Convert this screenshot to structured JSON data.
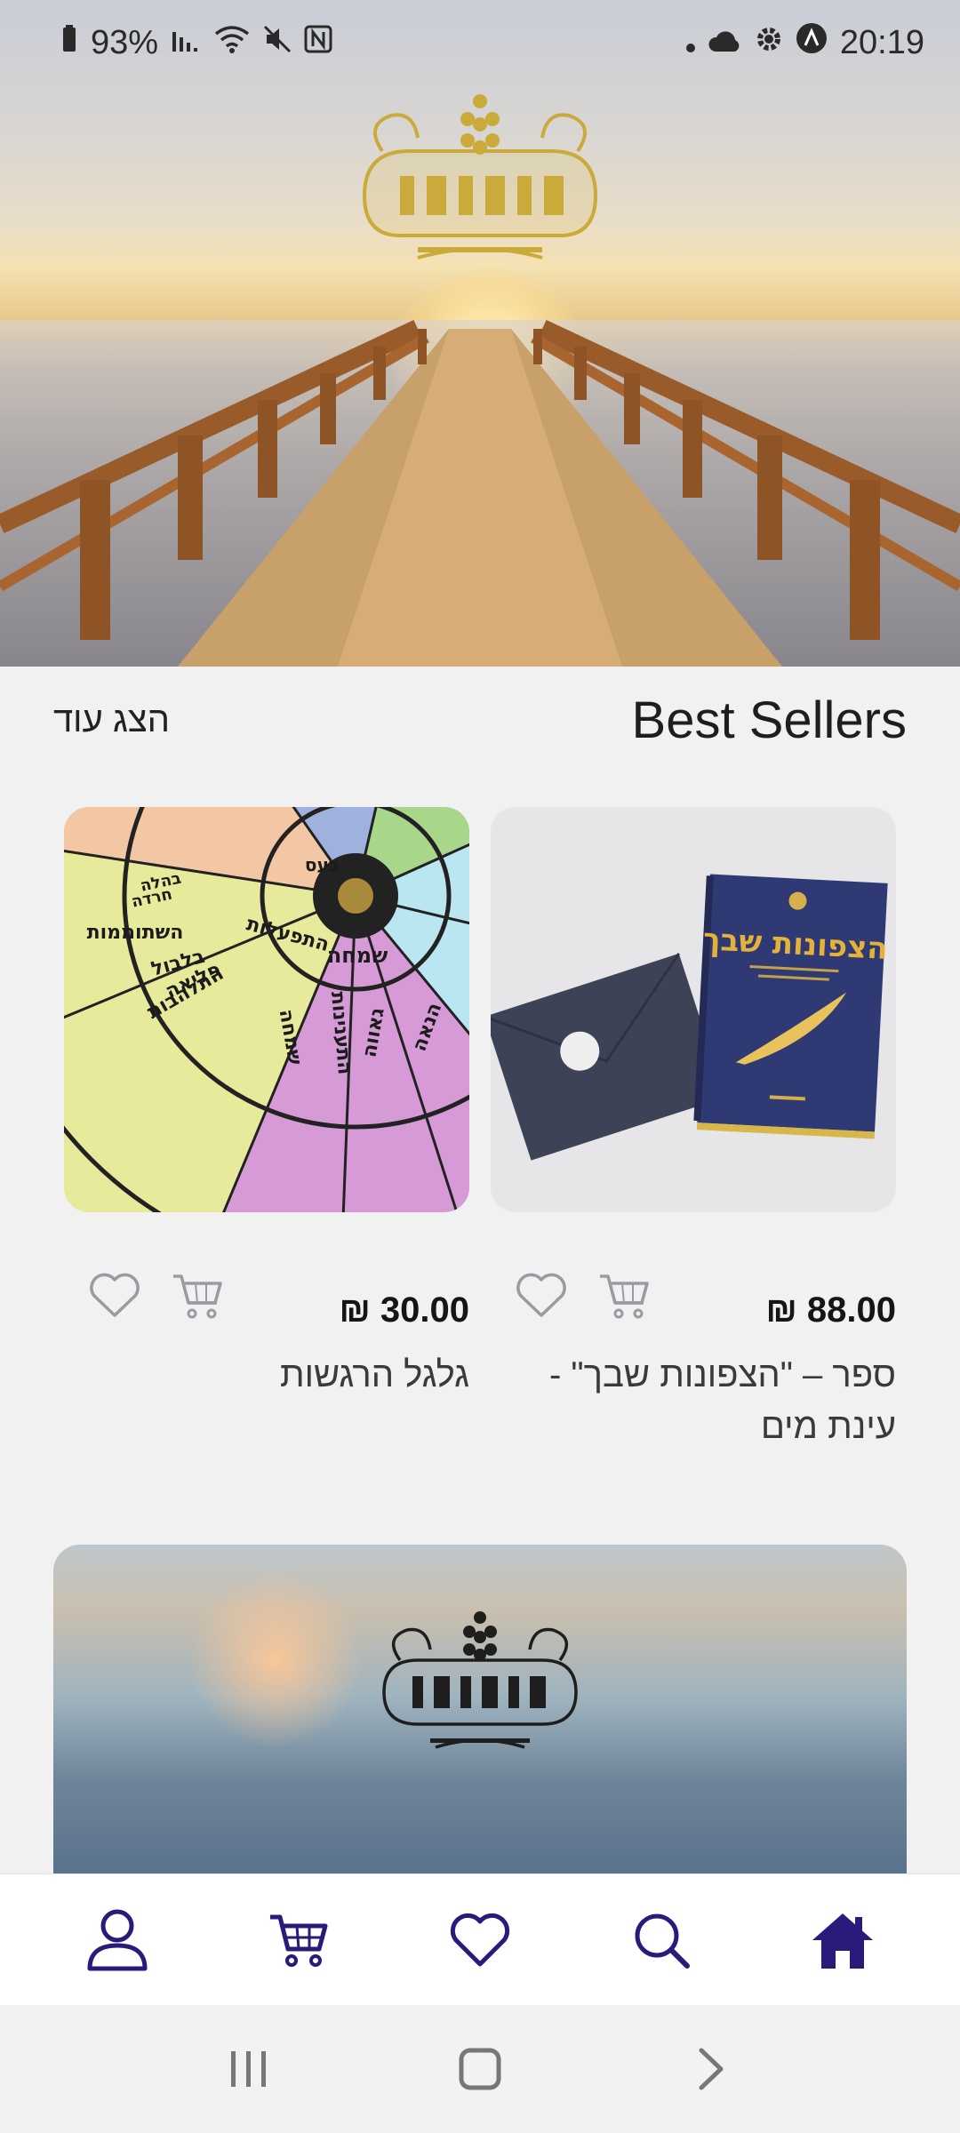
{
  "status_bar": {
    "battery": "93%",
    "time": "20:19"
  },
  "section": {
    "title": "Best Sellers",
    "show_more": "הצג עוד"
  },
  "products": [
    {
      "name": "ספר – \"הצפונות שבך\" -עינת מים",
      "price": "₪ 88.00",
      "image_text": "הצפונות שבך"
    },
    {
      "name": "גלגל הרגשות",
      "price": "₪ 30.00",
      "image_text": [
        "שמחה",
        "התלהבות",
        "השתוממות",
        "בלבול",
        "פליאה",
        "שמחה",
        "התענינות",
        "גאווה",
        "הנאה",
        "כעס",
        "התפעלות",
        "חרדה",
        "בהלה"
      ]
    }
  ],
  "bottom_nav": {
    "items": [
      "profile-icon",
      "cart-icon",
      "heart-icon",
      "search-icon",
      "home-icon"
    ],
    "active": "home-icon",
    "accent": "#2b1a7a"
  },
  "colors": {
    "background": "#f1f1f1",
    "accent": "#2b1a7a",
    "icon_gray": "#9a9aa2"
  }
}
